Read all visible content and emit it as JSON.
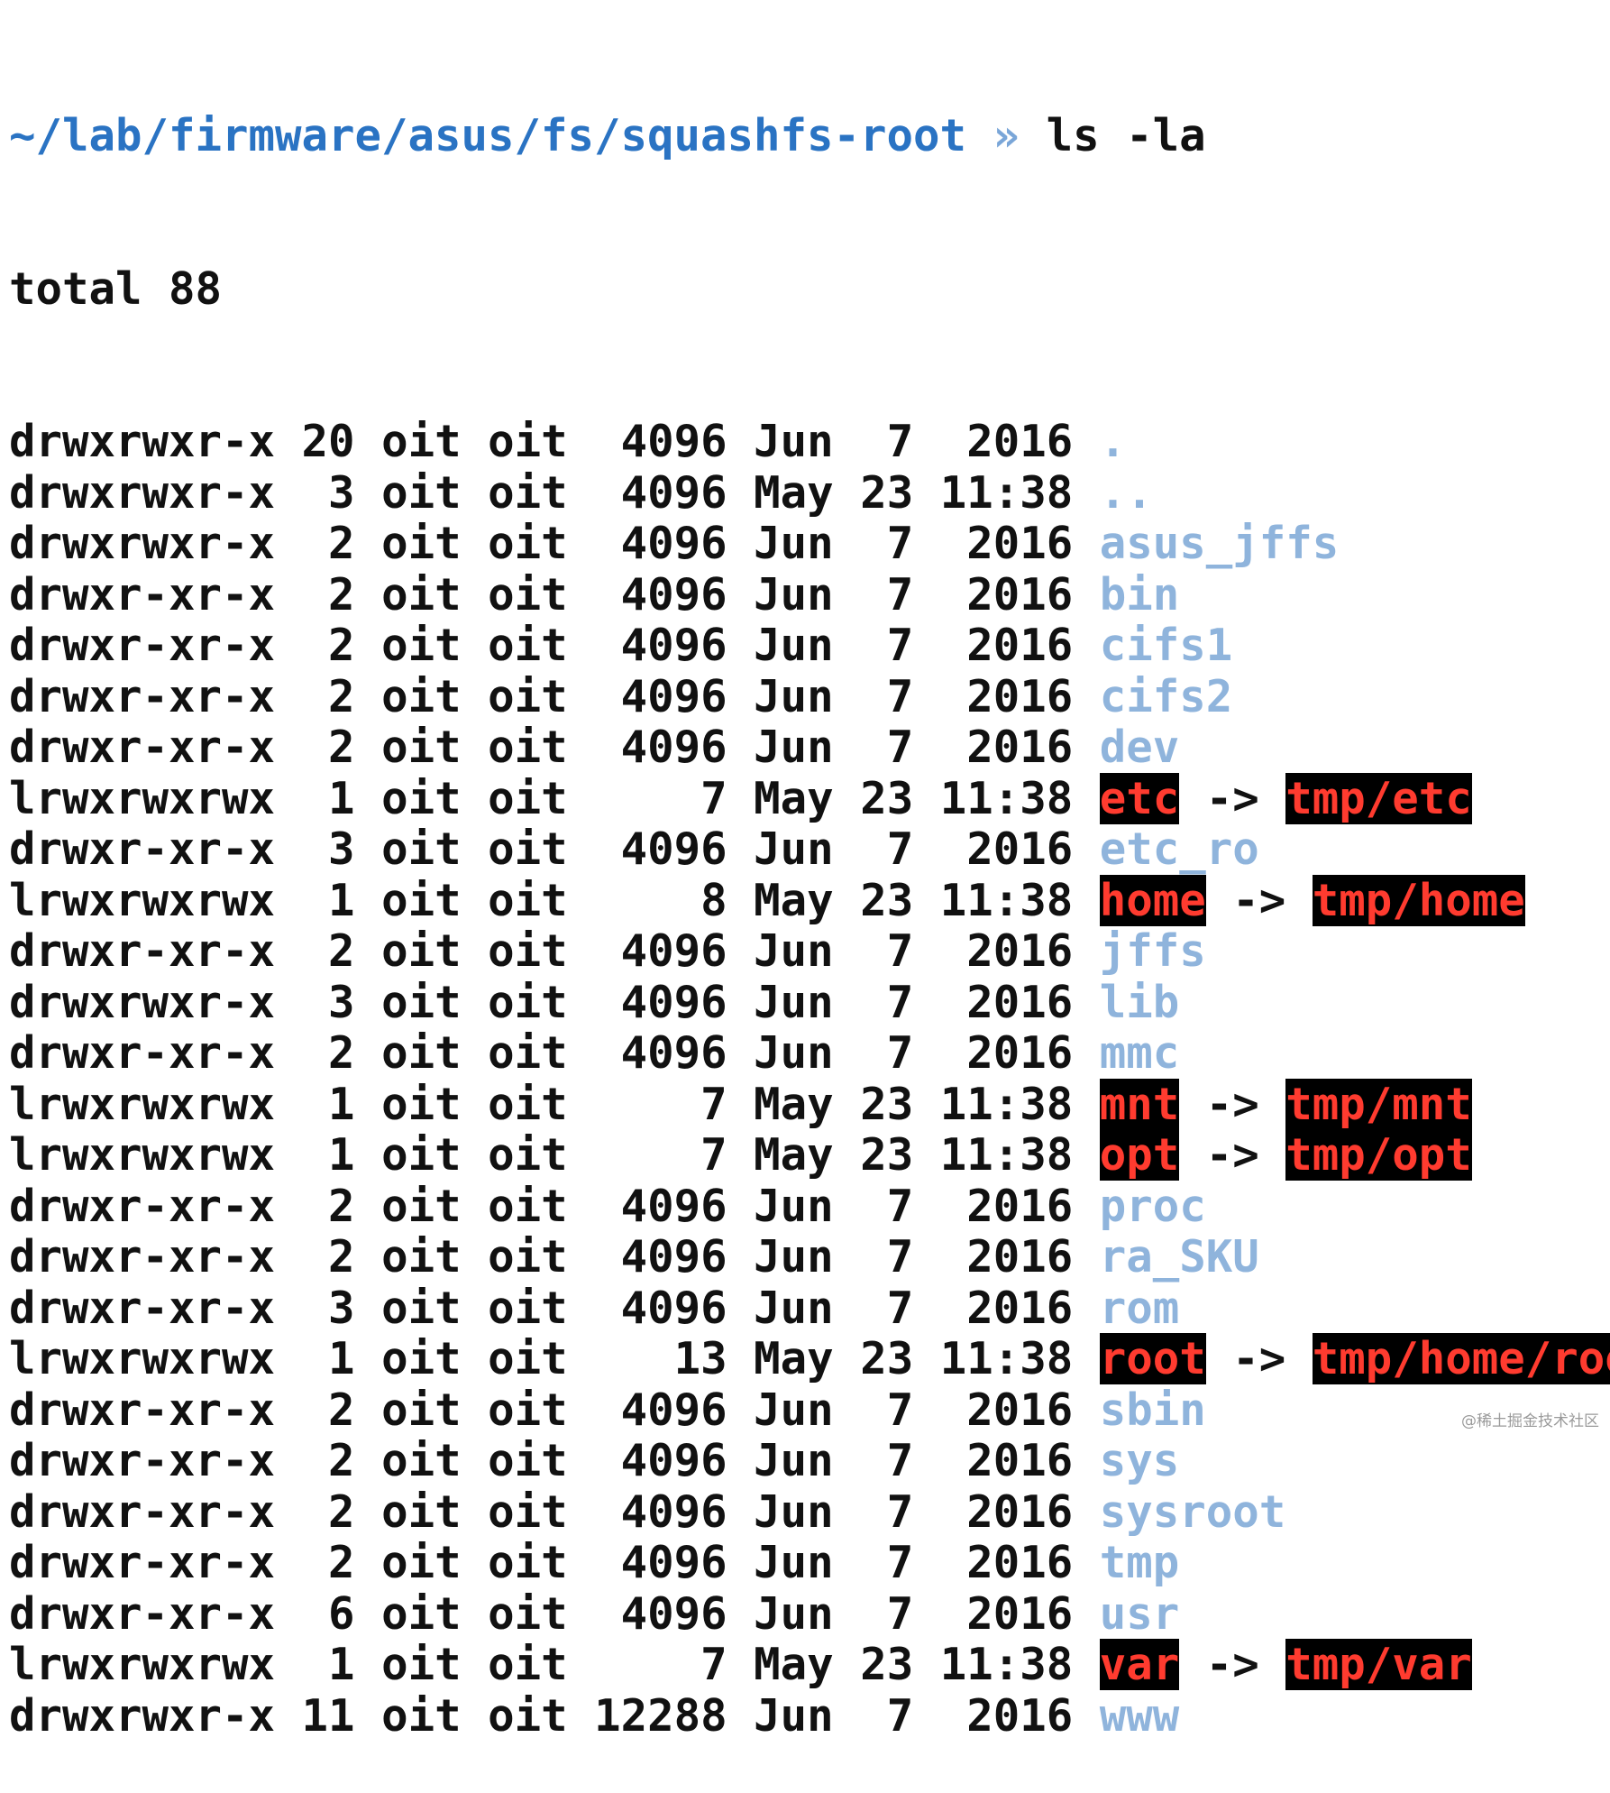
{
  "terminal": {
    "prompt": {
      "path": "~/lab/firmware/asus/fs/squashfs-root",
      "symbol": "»",
      "command": "ls -la"
    },
    "total": "total 88",
    "entries": [
      {
        "perms": "drwxrwxr-x",
        "links": "20",
        "owner": "oit",
        "group": "oit",
        "size": "4096",
        "month": "Jun",
        "day": "7",
        "time": "2016",
        "name": ".",
        "target": null
      },
      {
        "perms": "drwxrwxr-x",
        "links": "3",
        "owner": "oit",
        "group": "oit",
        "size": "4096",
        "month": "May",
        "day": "23",
        "time": "11:38",
        "name": "..",
        "target": null
      },
      {
        "perms": "drwxrwxr-x",
        "links": "2",
        "owner": "oit",
        "group": "oit",
        "size": "4096",
        "month": "Jun",
        "day": "7",
        "time": "2016",
        "name": "asus_jffs",
        "target": null
      },
      {
        "perms": "drwxr-xr-x",
        "links": "2",
        "owner": "oit",
        "group": "oit",
        "size": "4096",
        "month": "Jun",
        "day": "7",
        "time": "2016",
        "name": "bin",
        "target": null
      },
      {
        "perms": "drwxr-xr-x",
        "links": "2",
        "owner": "oit",
        "group": "oit",
        "size": "4096",
        "month": "Jun",
        "day": "7",
        "time": "2016",
        "name": "cifs1",
        "target": null
      },
      {
        "perms": "drwxr-xr-x",
        "links": "2",
        "owner": "oit",
        "group": "oit",
        "size": "4096",
        "month": "Jun",
        "day": "7",
        "time": "2016",
        "name": "cifs2",
        "target": null
      },
      {
        "perms": "drwxr-xr-x",
        "links": "2",
        "owner": "oit",
        "group": "oit",
        "size": "4096",
        "month": "Jun",
        "day": "7",
        "time": "2016",
        "name": "dev",
        "target": null
      },
      {
        "perms": "lrwxrwxrwx",
        "links": "1",
        "owner": "oit",
        "group": "oit",
        "size": "7",
        "month": "May",
        "day": "23",
        "time": "11:38",
        "name": "etc",
        "target": "tmp/etc"
      },
      {
        "perms": "drwxr-xr-x",
        "links": "3",
        "owner": "oit",
        "group": "oit",
        "size": "4096",
        "month": "Jun",
        "day": "7",
        "time": "2016",
        "name": "etc_ro",
        "target": null
      },
      {
        "perms": "lrwxrwxrwx",
        "links": "1",
        "owner": "oit",
        "group": "oit",
        "size": "8",
        "month": "May",
        "day": "23",
        "time": "11:38",
        "name": "home",
        "target": "tmp/home"
      },
      {
        "perms": "drwxr-xr-x",
        "links": "2",
        "owner": "oit",
        "group": "oit",
        "size": "4096",
        "month": "Jun",
        "day": "7",
        "time": "2016",
        "name": "jffs",
        "target": null
      },
      {
        "perms": "drwxrwxr-x",
        "links": "3",
        "owner": "oit",
        "group": "oit",
        "size": "4096",
        "month": "Jun",
        "day": "7",
        "time": "2016",
        "name": "lib",
        "target": null
      },
      {
        "perms": "drwxr-xr-x",
        "links": "2",
        "owner": "oit",
        "group": "oit",
        "size": "4096",
        "month": "Jun",
        "day": "7",
        "time": "2016",
        "name": "mmc",
        "target": null
      },
      {
        "perms": "lrwxrwxrwx",
        "links": "1",
        "owner": "oit",
        "group": "oit",
        "size": "7",
        "month": "May",
        "day": "23",
        "time": "11:38",
        "name": "mnt",
        "target": "tmp/mnt"
      },
      {
        "perms": "lrwxrwxrwx",
        "links": "1",
        "owner": "oit",
        "group": "oit",
        "size": "7",
        "month": "May",
        "day": "23",
        "time": "11:38",
        "name": "opt",
        "target": "tmp/opt"
      },
      {
        "perms": "drwxr-xr-x",
        "links": "2",
        "owner": "oit",
        "group": "oit",
        "size": "4096",
        "month": "Jun",
        "day": "7",
        "time": "2016",
        "name": "proc",
        "target": null
      },
      {
        "perms": "drwxr-xr-x",
        "links": "2",
        "owner": "oit",
        "group": "oit",
        "size": "4096",
        "month": "Jun",
        "day": "7",
        "time": "2016",
        "name": "ra_SKU",
        "target": null
      },
      {
        "perms": "drwxr-xr-x",
        "links": "3",
        "owner": "oit",
        "group": "oit",
        "size": "4096",
        "month": "Jun",
        "day": "7",
        "time": "2016",
        "name": "rom",
        "target": null
      },
      {
        "perms": "lrwxrwxrwx",
        "links": "1",
        "owner": "oit",
        "group": "oit",
        "size": "13",
        "month": "May",
        "day": "23",
        "time": "11:38",
        "name": "root",
        "target": "tmp/home/root"
      },
      {
        "perms": "drwxr-xr-x",
        "links": "2",
        "owner": "oit",
        "group": "oit",
        "size": "4096",
        "month": "Jun",
        "day": "7",
        "time": "2016",
        "name": "sbin",
        "target": null
      },
      {
        "perms": "drwxr-xr-x",
        "links": "2",
        "owner": "oit",
        "group": "oit",
        "size": "4096",
        "month": "Jun",
        "day": "7",
        "time": "2016",
        "name": "sys",
        "target": null
      },
      {
        "perms": "drwxr-xr-x",
        "links": "2",
        "owner": "oit",
        "group": "oit",
        "size": "4096",
        "month": "Jun",
        "day": "7",
        "time": "2016",
        "name": "sysroot",
        "target": null
      },
      {
        "perms": "drwxr-xr-x",
        "links": "2",
        "owner": "oit",
        "group": "oit",
        "size": "4096",
        "month": "Jun",
        "day": "7",
        "time": "2016",
        "name": "tmp",
        "target": null
      },
      {
        "perms": "drwxr-xr-x",
        "links": "6",
        "owner": "oit",
        "group": "oit",
        "size": "4096",
        "month": "Jun",
        "day": "7",
        "time": "2016",
        "name": "usr",
        "target": null
      },
      {
        "perms": "lrwxrwxrwx",
        "links": "1",
        "owner": "oit",
        "group": "oit",
        "size": "7",
        "month": "May",
        "day": "23",
        "time": "11:38",
        "name": "var",
        "target": "tmp/var"
      },
      {
        "perms": "drwxrwxr-x",
        "links": "11",
        "owner": "oit",
        "group": "oit",
        "size": "12288",
        "month": "Jun",
        "day": "7",
        "time": "2016",
        "name": "www",
        "target": null
      }
    ]
  },
  "watermark": "@稀土掘金技术社区",
  "colors": {
    "prompt_path": "#2a73c3",
    "directory": "#8fb4dc",
    "symlink_fg": "#ff3b2f",
    "symlink_bg": "#000000",
    "text": "#111111"
  }
}
